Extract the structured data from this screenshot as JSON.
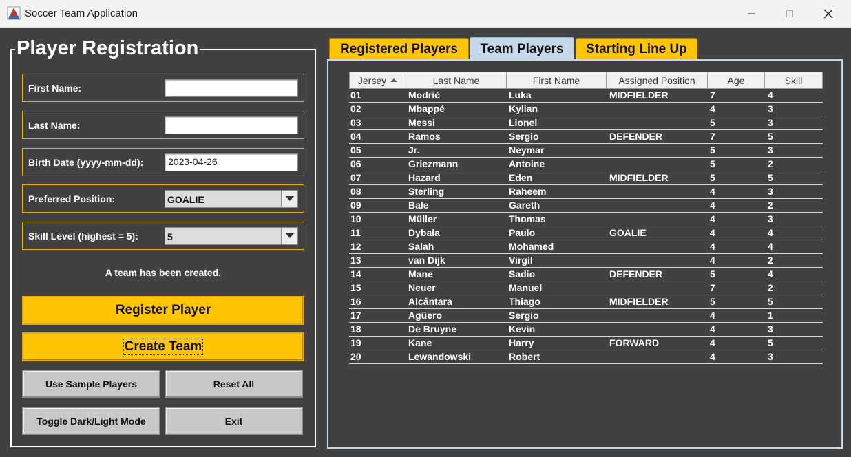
{
  "window": {
    "title": "Soccer Team Application"
  },
  "registration": {
    "title": "Player Registration",
    "fields": {
      "first_name_label": "First Name:",
      "first_name_value": "",
      "last_name_label": "Last Name:",
      "last_name_value": "",
      "birth_date_label": "Birth Date (yyyy-mm-dd):",
      "birth_date_value": "2023-04-26",
      "preferred_position_label": "Preferred Position:",
      "preferred_position_value": "GOALIE",
      "skill_level_label": "Skill Level (highest = 5):",
      "skill_level_value": "5"
    },
    "status_message": "A team has been created.",
    "buttons": {
      "register": "Register Player",
      "create_team": "Create Team",
      "sample_players": "Use Sample Players",
      "reset_all": "Reset All",
      "toggle_mode": "Toggle Dark/Light Mode",
      "exit": "Exit"
    }
  },
  "tabs": [
    {
      "label": "Registered Players",
      "active": false
    },
    {
      "label": "Team Players",
      "active": true
    },
    {
      "label": "Starting Line Up",
      "active": false
    }
  ],
  "table": {
    "columns": [
      "Jersey",
      "Last Name",
      "First Name",
      "Assigned Position",
      "Age",
      "Skill"
    ],
    "sorted_column": "Jersey",
    "rows": [
      [
        "01",
        "Modrić",
        "Luka",
        "MIDFIELDER",
        "7",
        "4"
      ],
      [
        "02",
        "Mbappé",
        "Kylian",
        "",
        "4",
        "3"
      ],
      [
        "03",
        "Messi",
        "Lionel",
        "",
        "5",
        "3"
      ],
      [
        "04",
        "Ramos",
        "Sergio",
        "DEFENDER",
        "7",
        "5"
      ],
      [
        "05",
        "Jr.",
        "Neymar",
        "",
        "5",
        "3"
      ],
      [
        "06",
        "Griezmann",
        "Antoine",
        "",
        "5",
        "2"
      ],
      [
        "07",
        "Hazard",
        "Eden",
        "MIDFIELDER",
        "5",
        "5"
      ],
      [
        "08",
        "Sterling",
        "Raheem",
        "",
        "4",
        "3"
      ],
      [
        "09",
        "Bale",
        "Gareth",
        "",
        "4",
        "2"
      ],
      [
        "10",
        "Müller",
        "Thomas",
        "",
        "4",
        "3"
      ],
      [
        "11",
        "Dybala",
        "Paulo",
        "GOALIE",
        "4",
        "4"
      ],
      [
        "12",
        "Salah",
        "Mohamed",
        "",
        "4",
        "4"
      ],
      [
        "13",
        "van Dijk",
        "Virgil",
        "",
        "4",
        "2"
      ],
      [
        "14",
        "Mane",
        "Sadio",
        "DEFENDER",
        "5",
        "4"
      ],
      [
        "15",
        "Neuer",
        "Manuel",
        "",
        "7",
        "2"
      ],
      [
        "16",
        "Alcântara",
        "Thiago",
        "MIDFIELDER",
        "5",
        "5"
      ],
      [
        "17",
        "Agüero",
        "Sergio",
        "",
        "4",
        "1"
      ],
      [
        "18",
        "De Bruyne",
        "Kevin",
        "",
        "4",
        "3"
      ],
      [
        "19",
        "Kane",
        "Harry",
        "FORWARD",
        "4",
        "5"
      ],
      [
        "20",
        "Lewandowski",
        "Robert",
        "",
        "4",
        "3"
      ]
    ]
  },
  "icons": {
    "app": "soccer-app-icon",
    "minimize": "minimize-icon",
    "maximize": "maximize-icon",
    "close": "close-icon",
    "dropdown": "chevron-down-icon",
    "sort": "sort-ascending-icon"
  },
  "colors": {
    "background": "#414141",
    "accent_yellow": "#ffc500",
    "active_tab": "#c6d9ec",
    "text": "#ffffff"
  }
}
